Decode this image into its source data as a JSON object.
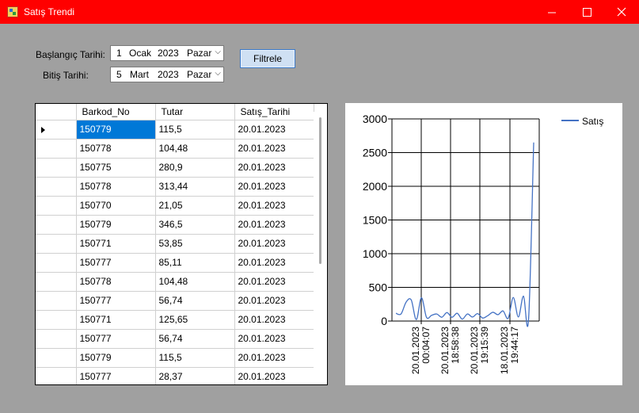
{
  "window": {
    "title": "Satış Trendi"
  },
  "controls": {
    "start_label": "Başlangıç Tarihi:",
    "end_label": "Bitiş Tarihi:",
    "start_date": {
      "day": "1",
      "month": "Ocak",
      "year": "2023",
      "weekday": "Pazar"
    },
    "end_date": {
      "day": "5",
      "month": "Mart",
      "year": "2023",
      "weekday": "Pazar"
    },
    "filter_label": "Filtrele"
  },
  "grid": {
    "columns": [
      "Barkod_No",
      "Tutar",
      "Satış_Tarihi"
    ],
    "rows": [
      [
        "150779",
        "115,5",
        "20.01.2023"
      ],
      [
        "150778",
        "104,48",
        "20.01.2023"
      ],
      [
        "150775",
        "280,9",
        "20.01.2023"
      ],
      [
        "150778",
        "313,44",
        "20.01.2023"
      ],
      [
        "150770",
        "21,05",
        "20.01.2023"
      ],
      [
        "150779",
        "346,5",
        "20.01.2023"
      ],
      [
        "150771",
        "53,85",
        "20.01.2023"
      ],
      [
        "150777",
        "85,11",
        "20.01.2023"
      ],
      [
        "150778",
        "104,48",
        "20.01.2023"
      ],
      [
        "150777",
        "56,74",
        "20.01.2023"
      ],
      [
        "150771",
        "125,65",
        "20.01.2023"
      ],
      [
        "150777",
        "56,74",
        "20.01.2023"
      ],
      [
        "150779",
        "115,5",
        "20.01.2023"
      ],
      [
        "150777",
        "28,37",
        "20.01.2023"
      ]
    ],
    "selected_row": 0
  },
  "chart_data": {
    "type": "line",
    "legend": "top-right",
    "grid": true,
    "ylim": [
      0,
      3000
    ],
    "yticks": [
      0,
      500,
      1000,
      1500,
      2000,
      2500,
      3000
    ],
    "xticks": [
      "20.01.2023\n00:04:07",
      "20.01.2023\n18:58:38",
      "20.01.2023\n19:15:39",
      "18.01.2023\n19:44:17"
    ],
    "series": [
      {
        "name": "Satış",
        "color": "#4472c4",
        "values": [
          115.5,
          104.48,
          280.9,
          313.44,
          21.05,
          346.5,
          53.85,
          85.11,
          104.48,
          56.74,
          125.65,
          56.74,
          115.5,
          28.37,
          105,
          60,
          110,
          45,
          80,
          130,
          95,
          150,
          40,
          350,
          60,
          370,
          30,
          2650
        ]
      }
    ]
  },
  "icons": {
    "minimize": "minimize-icon",
    "maximize": "maximize-icon",
    "close": "close-icon",
    "app": "app-icon",
    "dropdown": "chevron-down-icon"
  }
}
